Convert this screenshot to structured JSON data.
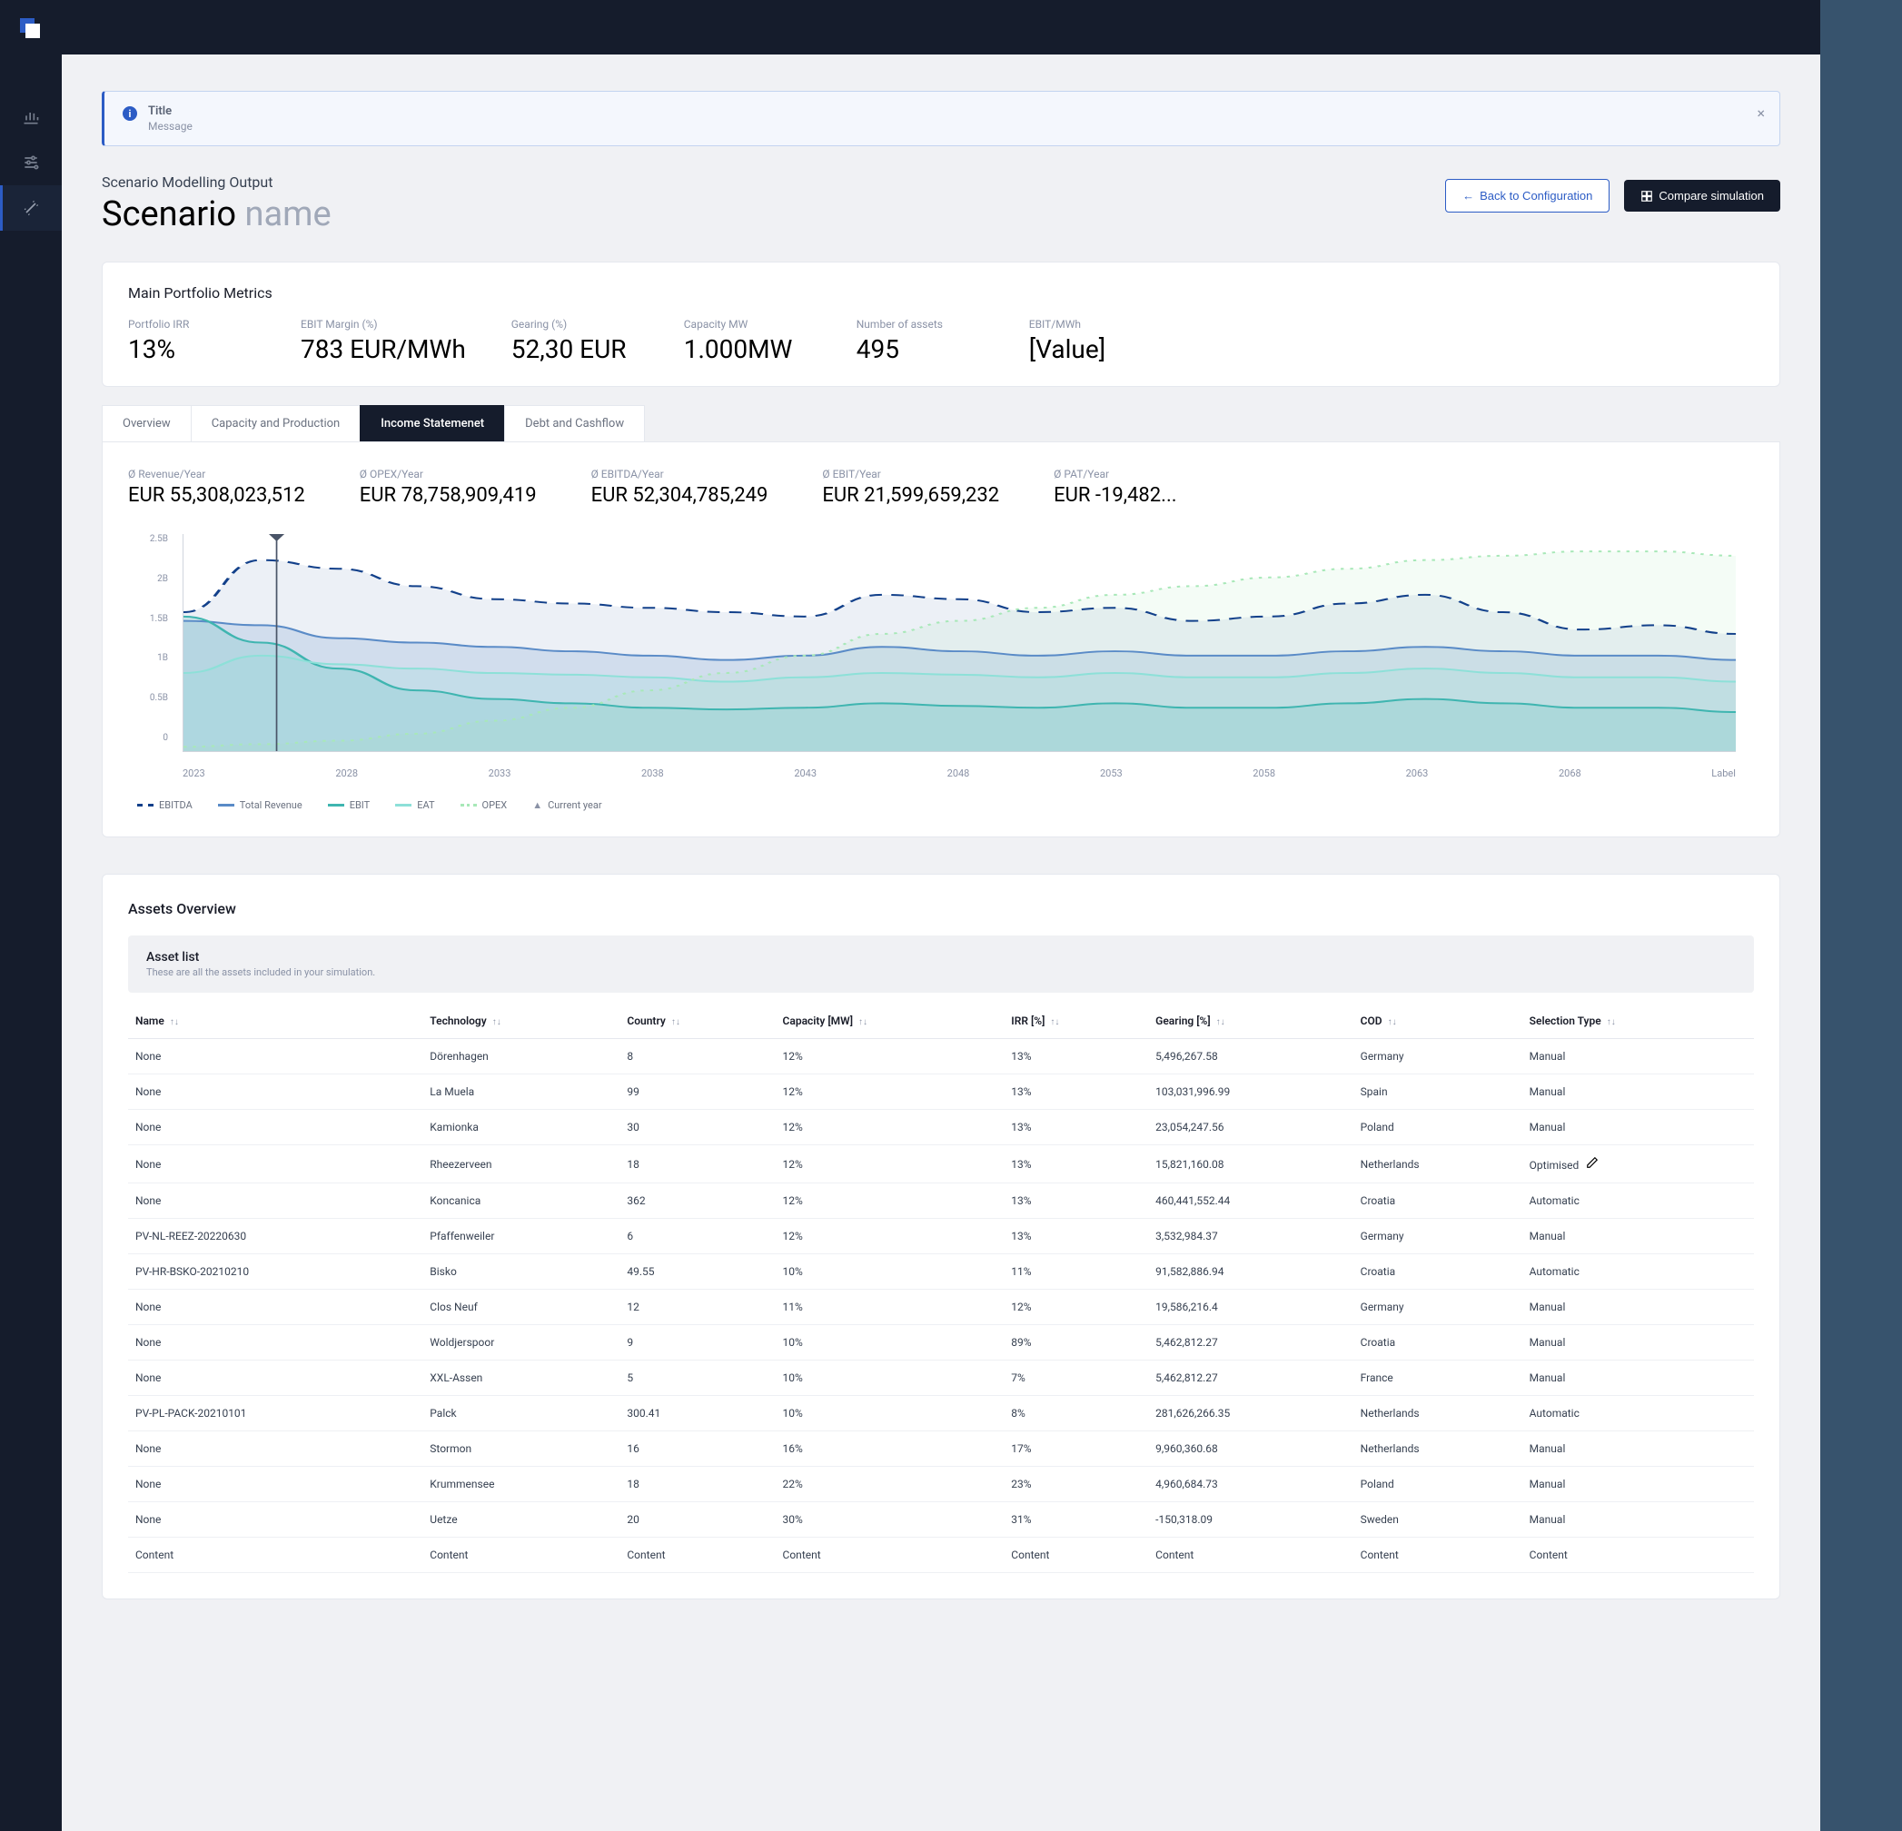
{
  "alert": {
    "title": "Title",
    "message": "Message"
  },
  "page": {
    "subtitle": "Scenario Modelling Output",
    "title_prefix": "Scenario ",
    "title_suffix": "name"
  },
  "buttons": {
    "back": "Back to Configuration",
    "compare": "Compare simulation"
  },
  "metrics": {
    "title": "Main Portfolio Metrics",
    "items": [
      {
        "label": "Portfolio IRR",
        "value": "13%"
      },
      {
        "label": "EBIT Margin (%)",
        "value": "783 EUR/MWh"
      },
      {
        "label": "Gearing (%)",
        "value": "52,30 EUR"
      },
      {
        "label": "Capacity MW",
        "value": "1.000MW"
      },
      {
        "label": "Number of assets",
        "value": "495"
      },
      {
        "label": "EBIT/MWh",
        "value": "[Value]"
      }
    ]
  },
  "tabs": [
    "Overview",
    "Capacity and Production",
    "Income Statemenet",
    "Debt and Cashflow"
  ],
  "active_tab": 2,
  "stats": [
    {
      "label": "Ø Revenue/Year",
      "value": "EUR 55,308,023,512"
    },
    {
      "label": "Ø OPEX/Year",
      "value": "EUR 78,758,909,419"
    },
    {
      "label": "Ø EBITDA/Year",
      "value": "EUR 52,304,785,249"
    },
    {
      "label": "Ø EBIT/Year",
      "value": "EUR 21,599,659,232"
    },
    {
      "label": "Ø PAT/Year",
      "value": "EUR -19,482..."
    }
  ],
  "chart_data": {
    "type": "area",
    "x_labels": [
      "2023",
      "2028",
      "2033",
      "2038",
      "2043",
      "2048",
      "2053",
      "2058",
      "2063",
      "2068",
      "Label"
    ],
    "y_ticks": [
      "2.5B",
      "2B",
      "1.5B",
      "1B",
      "0.5B",
      "0"
    ],
    "ylim": [
      0,
      2.5
    ],
    "current_year_index": 1.2,
    "series": [
      {
        "name": "EBITDA",
        "color": "#12408a",
        "style": "dashed",
        "values": [
          1.6,
          2.2,
          2.1,
          1.9,
          1.75,
          1.7,
          1.65,
          1.6,
          1.55,
          1.8,
          1.75,
          1.6,
          1.65,
          1.5,
          1.55,
          1.7,
          1.8,
          1.6,
          1.4,
          1.45,
          1.35
        ]
      },
      {
        "name": "Total Revenue",
        "color": "#5a8bc7",
        "style": "solid",
        "values": [
          1.5,
          1.45,
          1.3,
          1.25,
          1.2,
          1.15,
          1.1,
          1.05,
          1.1,
          1.2,
          1.15,
          1.1,
          1.15,
          1.1,
          1.1,
          1.15,
          1.2,
          1.15,
          1.1,
          1.1,
          1.05
        ]
      },
      {
        "name": "EBIT",
        "color": "#3fb5b0",
        "style": "solid",
        "values": [
          1.55,
          1.25,
          0.95,
          0.7,
          0.6,
          0.55,
          0.5,
          0.48,
          0.5,
          0.55,
          0.52,
          0.5,
          0.55,
          0.5,
          0.5,
          0.55,
          0.6,
          0.55,
          0.5,
          0.5,
          0.45
        ]
      },
      {
        "name": "EAT",
        "color": "#8de0d8",
        "style": "solid",
        "values": [
          0.9,
          1.1,
          1.0,
          0.95,
          0.9,
          0.88,
          0.85,
          0.8,
          0.85,
          0.9,
          0.88,
          0.85,
          0.9,
          0.85,
          0.85,
          0.9,
          0.95,
          0.9,
          0.85,
          0.85,
          0.8
        ]
      },
      {
        "name": "OPEX",
        "color": "#a8e8b8",
        "style": "dotted",
        "values": [
          0.05,
          0.08,
          0.12,
          0.2,
          0.35,
          0.5,
          0.7,
          0.9,
          1.1,
          1.35,
          1.5,
          1.65,
          1.8,
          1.9,
          2.0,
          2.1,
          2.2,
          2.25,
          2.3,
          2.3,
          2.25
        ]
      }
    ],
    "legend_extra": "Current year"
  },
  "assets": {
    "section_title": "Assets Overview",
    "list_title": "Asset list",
    "list_desc": "These are all the assets included in your simulation.",
    "columns": [
      "Name",
      "Technology",
      "Country",
      "Capacity [MW]",
      "IRR [%]",
      "Gearing [%]",
      "COD",
      "Selection Type"
    ],
    "rows": [
      [
        "None",
        "Dörenhagen",
        "8",
        "12%",
        "13%",
        "5,496,267.58",
        "Germany",
        "Manual"
      ],
      [
        "None",
        "La Muela",
        "99",
        "12%",
        "13%",
        "103,031,996.99",
        "Spain",
        "Manual"
      ],
      [
        "None",
        "Kamionka",
        "30",
        "12%",
        "13%",
        "23,054,247.56",
        "Poland",
        "Manual"
      ],
      [
        "None",
        "Rheezerveen",
        "18",
        "12%",
        "13%",
        "15,821,160.08",
        "Netherlands",
        "Optimised"
      ],
      [
        "None",
        "Koncanica",
        "362",
        "12%",
        "13%",
        "460,441,552.44",
        "Croatia",
        "Automatic"
      ],
      [
        "PV-NL-REEZ-20220630",
        "Pfaffenweiler",
        "6",
        "12%",
        "13%",
        "3,532,984.37",
        "Germany",
        "Manual"
      ],
      [
        "PV-HR-BSKO-20210210",
        "Bisko",
        "49.55",
        "10%",
        "11%",
        "91,582,886.94",
        "Croatia",
        "Automatic"
      ],
      [
        "None",
        "Clos Neuf",
        "12",
        "11%",
        "12%",
        "19,586,216.4",
        "Germany",
        "Manual"
      ],
      [
        "None",
        "Woldjerspoor",
        "9",
        "10%",
        "89%",
        "5,462,812.27",
        "Croatia",
        "Manual"
      ],
      [
        "None",
        "XXL-Assen",
        "5",
        "10%",
        "7%",
        "5,462,812.27",
        "France",
        "Manual"
      ],
      [
        "PV-PL-PACK-20210101",
        "Palck",
        "300.41",
        "10%",
        "8%",
        "281,626,266.35",
        "Netherlands",
        "Automatic"
      ],
      [
        "None",
        "Stormon",
        "16",
        "16%",
        "17%",
        "9,960,360.68",
        "Netherlands",
        "Manual"
      ],
      [
        "None",
        "Krummensee",
        "18",
        "22%",
        "23%",
        "4,960,684.73",
        "Poland",
        "Manual"
      ],
      [
        "None",
        "Uetze",
        "20",
        "30%",
        "31%",
        "-150,318.09",
        "Sweden",
        "Manual"
      ],
      [
        "Content",
        "Content",
        "Content",
        "Content",
        "Content",
        "Content",
        "Content",
        "Content"
      ]
    ],
    "hover_row": 3
  }
}
